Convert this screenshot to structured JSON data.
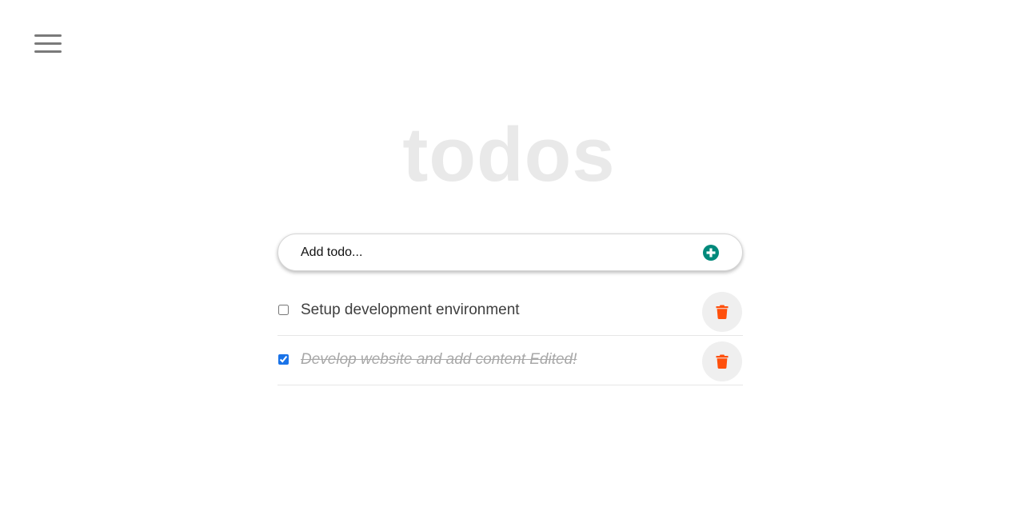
{
  "header": {
    "menu_icon": "hamburger-menu-icon",
    "title": "todos"
  },
  "add_todo": {
    "placeholder": "Add todo...",
    "add_icon": "plus-circle-icon",
    "accent_color": "#00897b"
  },
  "todos": [
    {
      "text": "Setup development environment",
      "completed": false,
      "delete_icon": "trash-icon"
    },
    {
      "text": "Develop website and add content Edited!",
      "completed": true,
      "delete_icon": "trash-icon"
    }
  ],
  "colors": {
    "delete_icon": "#ff4f0b",
    "title": "#e9e9e9",
    "checkbox_checked": "#1a73e8"
  }
}
